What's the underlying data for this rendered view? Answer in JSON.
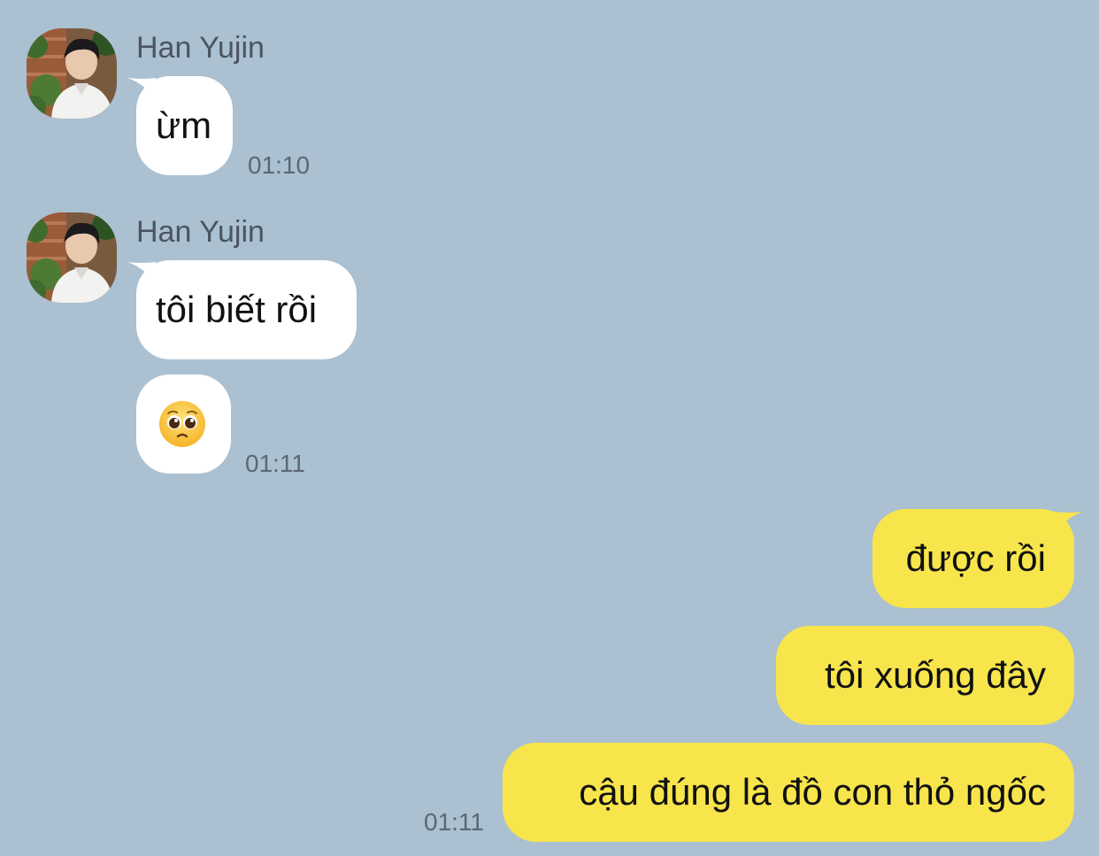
{
  "colors": {
    "background": "#abc0d0",
    "incoming_bubble": "#ffffff",
    "outgoing_bubble": "#f8e54c",
    "timestamp": "#5b6873",
    "sender_name": "#4a5560"
  },
  "messages": {
    "group1": {
      "sender": "Han Yujin",
      "avatar_icon": "profile-photo",
      "bubbles": [
        "ừm"
      ],
      "time": "01:10"
    },
    "group2": {
      "sender": "Han Yujin",
      "avatar_icon": "profile-photo",
      "bubbles": [
        "tôi biết rồi"
      ],
      "emoji": "pleading-face-emoji",
      "time": "01:11"
    },
    "group3": {
      "bubbles": [
        "được rồi",
        "tôi xuống đây",
        "cậu đúng là đồ con thỏ ngốc"
      ],
      "time": "01:11"
    }
  }
}
